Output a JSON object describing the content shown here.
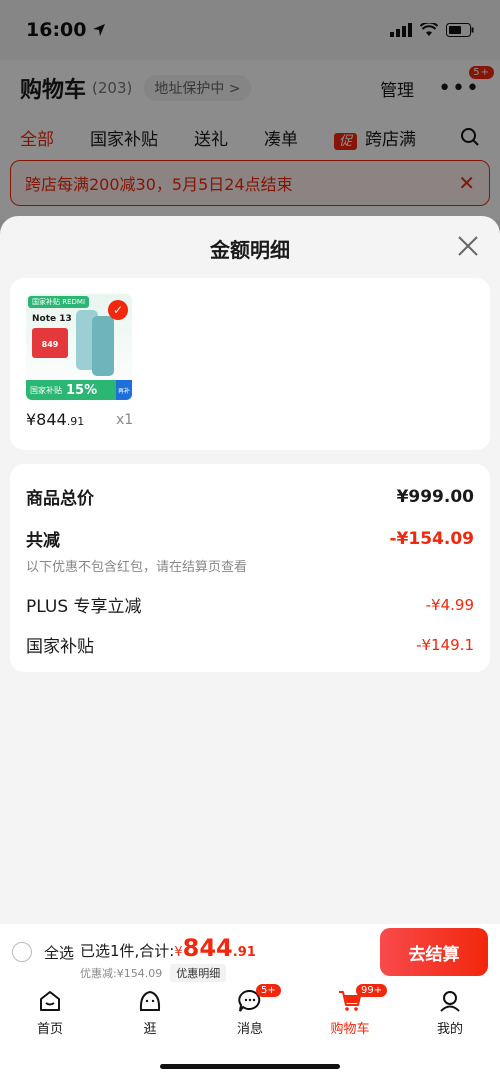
{
  "status": {
    "time": "16:00"
  },
  "underlay": {
    "title": "购物车",
    "count": "(203)",
    "address": "地址保护中 >",
    "manage": "管理",
    "more_badge": "5+",
    "tabs": [
      "全部",
      "国家补贴",
      "送礼",
      "凑单",
      "跨店满"
    ],
    "promo_tag": "促",
    "banner": "跨店每满200减30，5月5日24点结束"
  },
  "sheet": {
    "title": "金额明细",
    "product": {
      "thumb_brand": "国家补贴 REDMI",
      "thumb_model": "Note 13",
      "thumb_price": "849",
      "thumb_subsidy_label": "国家补贴",
      "thumb_subsidy": "15%",
      "thumb_side": "再补",
      "price_main": "¥844",
      "price_cents": ".91",
      "qty": "x1"
    },
    "rows": {
      "total_label": "商品总价",
      "total_value": "¥999.00",
      "reduce_label": "共减",
      "reduce_value": "-¥154.09",
      "note": "以下优惠不包含红包，请在结算页查看",
      "plus_label": "PLUS 专享立减",
      "plus_value": "-¥4.99",
      "subsidy_label": "国家补贴",
      "subsidy_value": "-¥149.1"
    }
  },
  "checkout": {
    "select_all": "全选",
    "selected": "已选1件,合计:",
    "currency": "¥",
    "amount": "844",
    "cents": ".91",
    "discount": "优惠减:¥154.09",
    "detail_label": "优惠明细",
    "button": "去结算"
  },
  "tabbar": {
    "home": "首页",
    "browse": "逛",
    "messages": "消息",
    "messages_badge": "5+",
    "cart": "购物车",
    "cart_badge": "99+",
    "mine": "我的"
  },
  "colors": {
    "accent": "#f2270c",
    "green": "#2bb673"
  }
}
